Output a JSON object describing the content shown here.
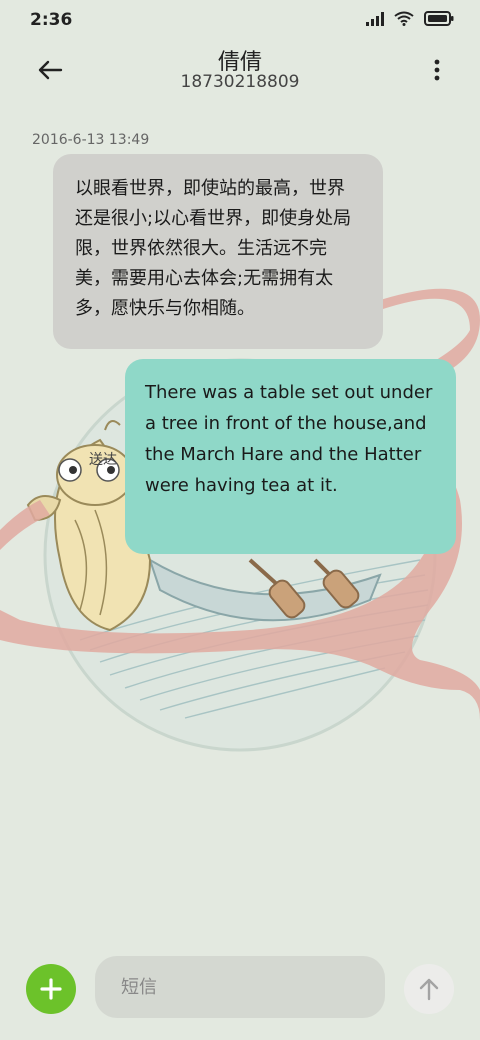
{
  "status_bar": {
    "time": "2:36"
  },
  "header": {
    "contact_name": "倩倩",
    "contact_number": "18730218809"
  },
  "conversation": {
    "timestamp": "2016-6-13 13:49",
    "incoming_message": "以眼看世界，即使站的最高，世界还是很小;以心看世界，即使身处局限，世界依然很大。生活远不完美，需要用心去体会;无需拥有太多，愿快乐与你相随。",
    "outgoing_message": "There was a table set out under a tree in front of the house,and the March Hare and the Hatter were having tea at it.",
    "sent_status": "送达"
  },
  "composer": {
    "placeholder": "短信"
  },
  "colors": {
    "background": "#e3e9e0",
    "incoming_bubble": "#d0d0cc",
    "outgoing_bubble": "#8fd8c8",
    "add_button": "#6cc22a",
    "ribbon": "#e0a9a0"
  },
  "icons": {
    "back": "back-arrow-icon",
    "more": "more-vertical-icon",
    "add": "plus-icon",
    "send": "send-arrow-up-icon",
    "signal": "signal-icon",
    "wifi": "wifi-icon",
    "battery": "battery-icon"
  }
}
